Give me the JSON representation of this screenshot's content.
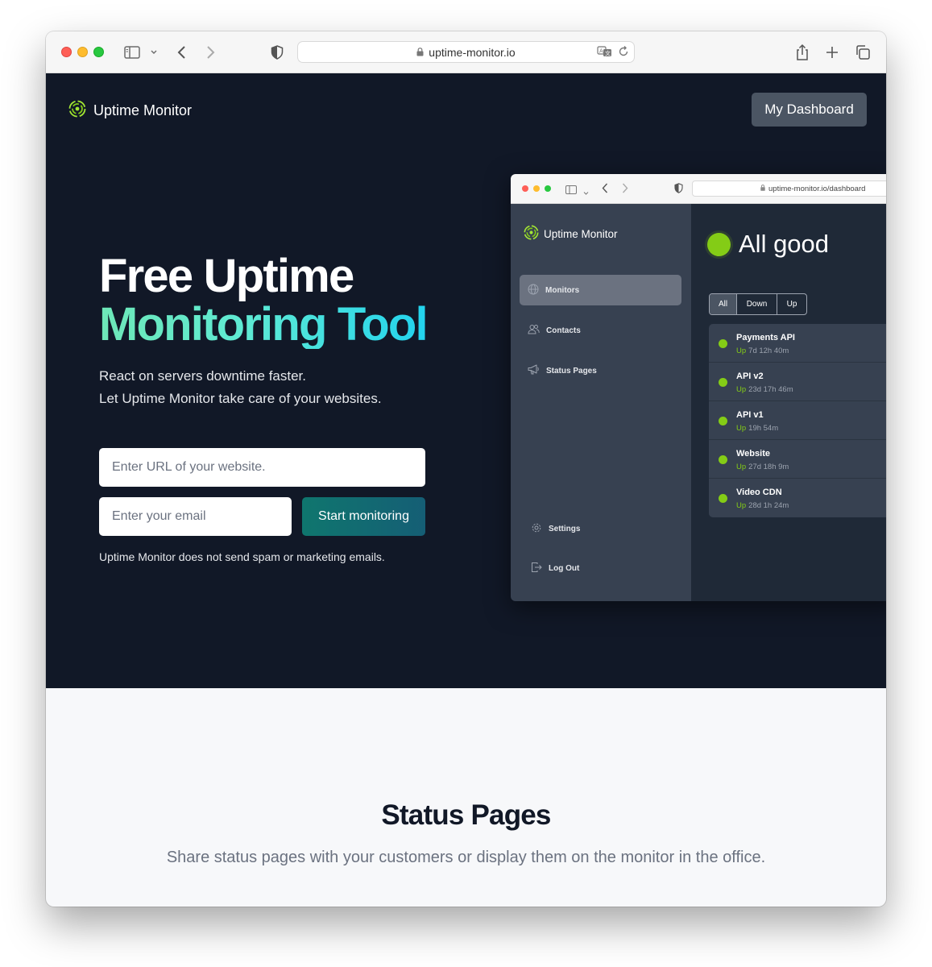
{
  "browser": {
    "url": "uptime-monitor.io"
  },
  "header": {
    "brand": "Uptime Monitor",
    "dashboard_button": "My Dashboard"
  },
  "hero": {
    "title_line1": "Free Uptime",
    "title_line2": "Monitoring Tool",
    "subtitle_line1": "React on servers downtime faster.",
    "subtitle_line2": "Let Uptime Monitor take care of your websites.",
    "url_placeholder": "Enter URL of your website.",
    "email_placeholder": "Enter your email",
    "start_button": "Start monitoring",
    "no_spam_note": "Uptime Monitor does not send spam or marketing emails."
  },
  "preview": {
    "url": "uptime-monitor.io/dashboard",
    "brand": "Uptime Monitor",
    "nav": [
      {
        "label": "Monitors",
        "icon": "globe-icon",
        "active": true
      },
      {
        "label": "Contacts",
        "icon": "users-icon",
        "active": false
      },
      {
        "label": "Status Pages",
        "icon": "megaphone-icon",
        "active": false
      }
    ],
    "nav_bottom": [
      {
        "label": "Settings",
        "icon": "gear-icon"
      },
      {
        "label": "Log Out",
        "icon": "logout-icon"
      }
    ],
    "status": "All good",
    "filters": [
      "All",
      "Down",
      "Up"
    ],
    "selected_filter": "All",
    "monitors": [
      {
        "name": "Payments API",
        "state": "Up",
        "uptime": "7d 12h 40m"
      },
      {
        "name": "API v2",
        "state": "Up",
        "uptime": "23d 17h 46m"
      },
      {
        "name": "API v1",
        "state": "Up",
        "uptime": "19h 54m"
      },
      {
        "name": "Website",
        "state": "Up",
        "uptime": "27d 18h 9m"
      },
      {
        "name": "Video CDN",
        "state": "Up",
        "uptime": "28d 1h 24m"
      }
    ]
  },
  "status_section": {
    "title": "Status Pages",
    "subtitle": "Share status pages with your customers or display them on the monitor in the office."
  },
  "colors": {
    "hero_bg": "#111827",
    "accent_green": "#84cc16",
    "gradient_start": "#6ee7b7",
    "gradient_end": "#22d3ee"
  }
}
